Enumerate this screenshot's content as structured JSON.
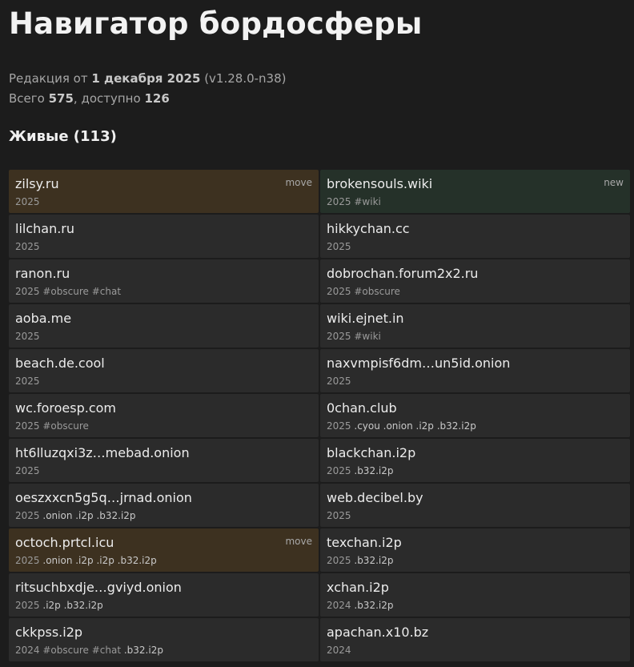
{
  "page": {
    "title": "Навигатор бордосферы",
    "edition_prefix": "Редакция от",
    "edition_date": "1 декабря 2025",
    "version": "(v1.28.0-n38)",
    "total_prefix": "Всего",
    "total": "575",
    "available_prefix": ", доступно",
    "available": "126"
  },
  "section": {
    "title": "Живые (113)"
  },
  "cards": [
    {
      "name": "zilsy.ru",
      "year": "2025",
      "tags": "",
      "mirrors": "",
      "badge": "move",
      "status": "move"
    },
    {
      "name": "brokensouls.wiki",
      "year": "2025",
      "tags": "#wiki",
      "mirrors": "",
      "badge": "new",
      "status": "new"
    },
    {
      "name": "lilchan.ru",
      "year": "2025",
      "tags": "",
      "mirrors": "",
      "badge": "",
      "status": ""
    },
    {
      "name": "hikkychan.cc",
      "year": "2025",
      "tags": "",
      "mirrors": "",
      "badge": "",
      "status": ""
    },
    {
      "name": "ranon.ru",
      "year": "2025",
      "tags": "#obscure #chat",
      "mirrors": "",
      "badge": "",
      "status": ""
    },
    {
      "name": "dobrochan.forum2x2.ru",
      "year": "2025",
      "tags": "#obscure",
      "mirrors": "",
      "badge": "",
      "status": ""
    },
    {
      "name": "aoba.me",
      "year": "2025",
      "tags": "",
      "mirrors": "",
      "badge": "",
      "status": ""
    },
    {
      "name": "wiki.ejnet.in",
      "year": "2025",
      "tags": "#wiki",
      "mirrors": "",
      "badge": "",
      "status": ""
    },
    {
      "name": "beach.de.cool",
      "year": "2025",
      "tags": "",
      "mirrors": "",
      "badge": "",
      "status": ""
    },
    {
      "name": "naxvmpisf6dm…un5id.onion",
      "year": "2025",
      "tags": "",
      "mirrors": "",
      "badge": "",
      "status": ""
    },
    {
      "name": "wc.foroesp.com",
      "year": "2025",
      "tags": "#obscure",
      "mirrors": "",
      "badge": "",
      "status": ""
    },
    {
      "name": "0chan.club",
      "year": "2025",
      "tags": "",
      "mirrors": ".cyou .onion .i2p .b32.i2p",
      "badge": "",
      "status": ""
    },
    {
      "name": "ht6lluzqxi3z…mebad.onion",
      "year": "2025",
      "tags": "",
      "mirrors": "",
      "badge": "",
      "status": ""
    },
    {
      "name": "blackchan.i2p",
      "year": "2025",
      "tags": "",
      "mirrors": ".b32.i2p",
      "badge": "",
      "status": ""
    },
    {
      "name": "oeszxxcn5g5q…jrnad.onion",
      "year": "2025",
      "tags": "",
      "mirrors": ".onion .i2p .b32.i2p",
      "badge": "",
      "status": ""
    },
    {
      "name": "web.decibel.by",
      "year": "2025",
      "tags": "",
      "mirrors": "",
      "badge": "",
      "status": ""
    },
    {
      "name": "octoch.prtcl.icu",
      "year": "2025",
      "tags": "",
      "mirrors": ".onion .i2p .i2p .b32.i2p",
      "badge": "move",
      "status": "move"
    },
    {
      "name": "texchan.i2p",
      "year": "2025",
      "tags": "",
      "mirrors": ".b32.i2p",
      "badge": "",
      "status": ""
    },
    {
      "name": "ritsuchbxdje…gviyd.onion",
      "year": "2025",
      "tags": "",
      "mirrors": ".i2p .b32.i2p",
      "badge": "",
      "status": ""
    },
    {
      "name": "xchan.i2p",
      "year": "2024",
      "tags": "",
      "mirrors": ".b32.i2p",
      "badge": "",
      "status": ""
    },
    {
      "name": "ckkpss.i2p",
      "year": "2024",
      "tags": "#obscure #chat",
      "mirrors": ".b32.i2p",
      "badge": "",
      "status": ""
    },
    {
      "name": "apachan.x10.bz",
      "year": "2024",
      "tags": "",
      "mirrors": "",
      "badge": "",
      "status": ""
    }
  ]
}
